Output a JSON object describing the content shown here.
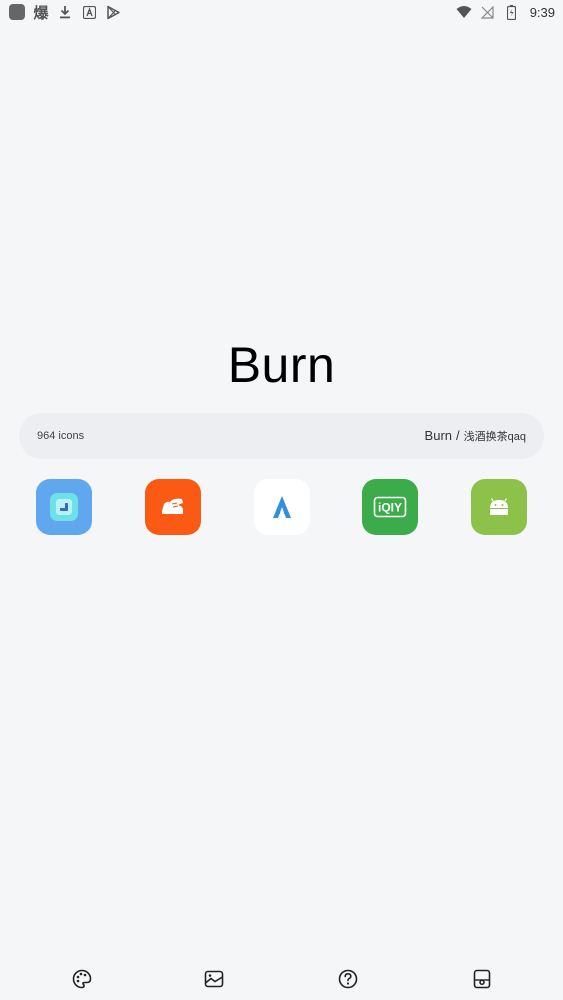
{
  "status_bar": {
    "left_icons": [
      "app-square-icon",
      "bao-char-icon",
      "download-icon",
      "font-app-icon",
      "play-store-icon"
    ],
    "bao_char": "爆",
    "right_icons": [
      "wifi-icon",
      "no-signal-icon",
      "battery-icon"
    ],
    "time": "9:39"
  },
  "title": "Burn",
  "info": {
    "icon_count": "964 icons",
    "theme_name": "Burn",
    "separator": "/",
    "author": "浅酒换茶qaq"
  },
  "app_icons": [
    {
      "name": "cube-app",
      "bg": "#5fa8f0"
    },
    {
      "name": "shoe-app",
      "bg": "#fa5a14"
    },
    {
      "name": "a-app",
      "bg": "#ffffff"
    },
    {
      "name": "iqiyi-app",
      "bg": "#3cab4a"
    },
    {
      "name": "android-app",
      "bg": "#8dc24a"
    }
  ],
  "iqiyi_text": "iQIY",
  "a_letter": "A",
  "bottom_nav": [
    "palette-icon",
    "wallpaper-icon",
    "help-icon",
    "apply-icon"
  ]
}
